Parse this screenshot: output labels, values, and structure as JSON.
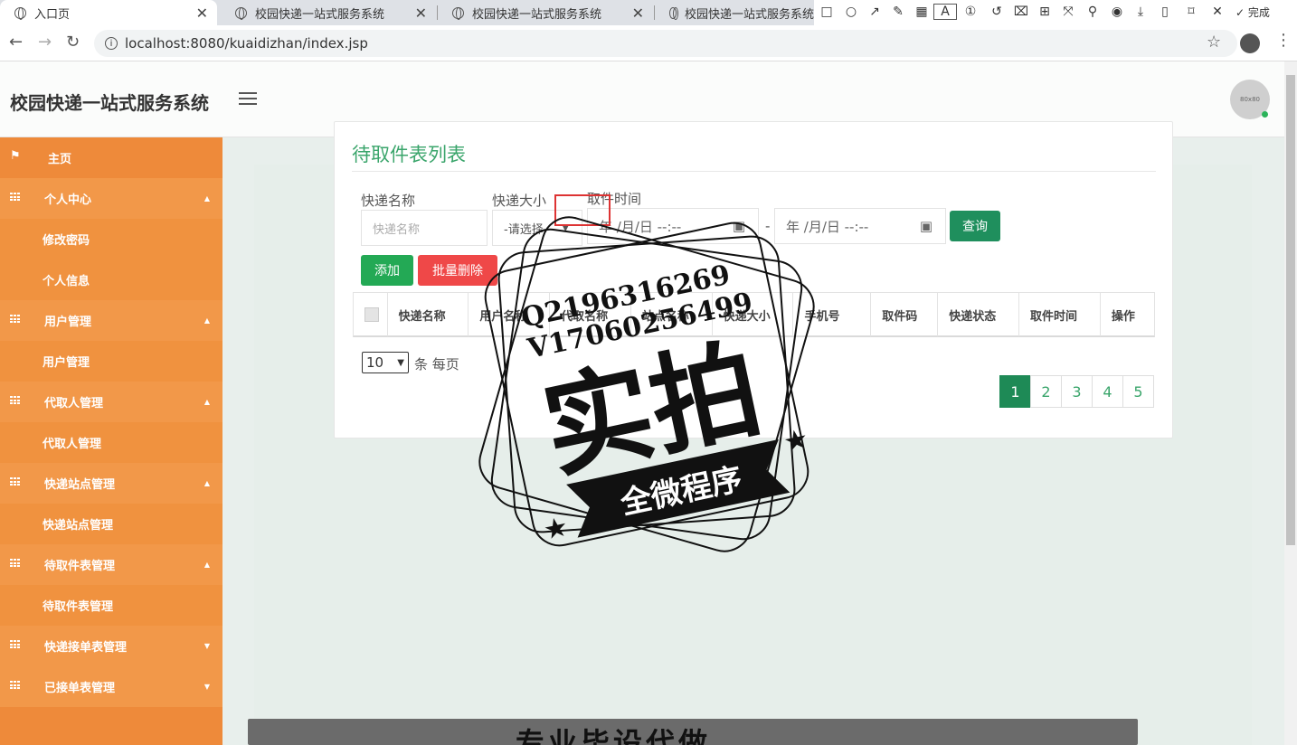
{
  "browser": {
    "tabs": [
      {
        "title": "入口页",
        "active": true
      },
      {
        "title": "校园快递一站式服务系统",
        "active": false
      },
      {
        "title": "校园快递一站式服务系统",
        "active": false
      },
      {
        "title": "校园快递一站式服务系统",
        "active": false
      }
    ],
    "url": "localhost:8080/kuaidizhan/index.jsp"
  },
  "capture_tool": {
    "done_label": "完成",
    "font_size": "12",
    "current_color": "#ee3333",
    "palette": [
      "#000000",
      "#808080",
      "#800000",
      "#e07020",
      "#2a8a2a",
      "#2050c0",
      "#802080",
      "#108080",
      "#ffffff",
      "#c0c0c0",
      "#ee3333",
      "#ffee00",
      "#90c020",
      "#4090e0",
      "#e020e0",
      "#20c0c0"
    ]
  },
  "app": {
    "title": "校园快递一站式服务系统",
    "avatar_text": "80x80"
  },
  "sidebar": {
    "items": [
      {
        "label": "主页",
        "type": "home"
      },
      {
        "label": "个人中心",
        "type": "parent",
        "caret": "▲"
      },
      {
        "label": "修改密码",
        "type": "child"
      },
      {
        "label": "个人信息",
        "type": "child"
      },
      {
        "label": "用户管理",
        "type": "parent",
        "caret": "▲"
      },
      {
        "label": "用户管理",
        "type": "child"
      },
      {
        "label": "代取人管理",
        "type": "parent",
        "caret": "▲"
      },
      {
        "label": "代取人管理",
        "type": "child"
      },
      {
        "label": "快递站点管理",
        "type": "parent",
        "caret": "▲"
      },
      {
        "label": "快递站点管理",
        "type": "child"
      },
      {
        "label": "待取件表管理",
        "type": "parent",
        "caret": "▲"
      },
      {
        "label": "待取件表管理",
        "type": "child"
      },
      {
        "label": "快递接单表管理",
        "type": "parent",
        "caret": "▼"
      },
      {
        "label": "已接单表管理",
        "type": "parent",
        "caret": "▼"
      }
    ]
  },
  "main": {
    "title": "待取件表列表",
    "filters": {
      "name_label": "快递名称",
      "name_placeholder": "快递名称",
      "size_label": "快递大小",
      "size_value": "-请选择-",
      "time_label": "取件时间",
      "date_start": "年 /月/日 --:--",
      "date_sep": "-",
      "date_end": "年 /月/日 --:--",
      "query_label": "查询"
    },
    "add_label": "添加",
    "batch_delete_label": "批量删除",
    "columns": [
      "快递名称",
      "用户名称",
      "代取名称",
      "站点名称",
      "快递大小",
      "手机号",
      "取件码",
      "快递状态",
      "取件时间",
      "操作"
    ],
    "page_size": "10",
    "page_size_suffix": "条 每页",
    "pages": [
      "1",
      "2",
      "3",
      "4",
      "5"
    ],
    "current_page": "1"
  },
  "watermark": {
    "line1": "Q2196316269",
    "line2": "V17060256499",
    "big": "实拍",
    "banner": "全微程序",
    "bottom": "专业毕设代做"
  }
}
